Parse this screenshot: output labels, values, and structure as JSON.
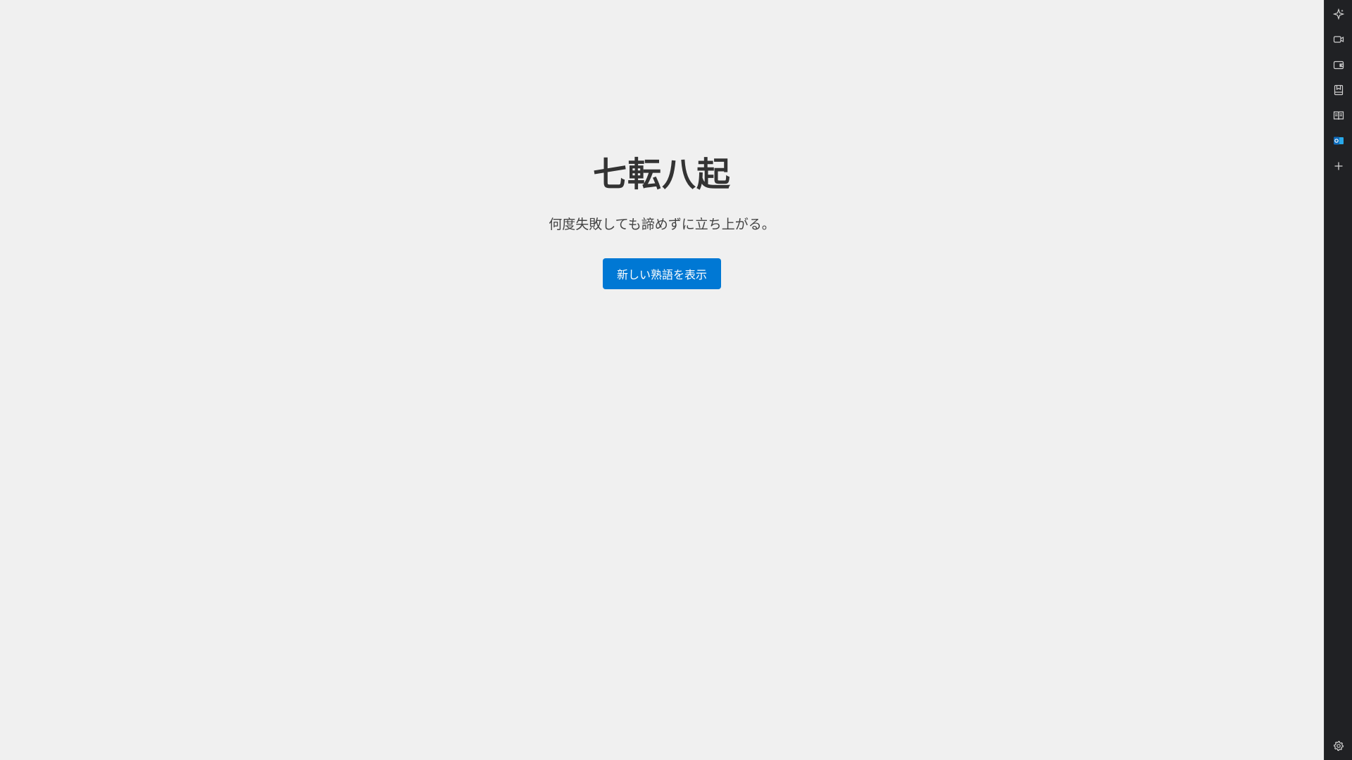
{
  "main": {
    "idiom": "七転八起",
    "meaning": "何度失敗しても諦めずに立ち上がる。",
    "button_label": "新しい熟語を表示",
    "button_color": "#0078d4"
  },
  "sidebar": {
    "background": "#202124",
    "items": [
      {
        "icon": "sparkle-icon"
      },
      {
        "icon": "video-icon"
      },
      {
        "icon": "wallet-icon"
      },
      {
        "icon": "bookmark-icon"
      },
      {
        "icon": "reading-view-icon"
      },
      {
        "icon": "outlook-icon"
      },
      {
        "icon": "add-icon"
      }
    ],
    "bottom_items": [
      {
        "icon": "settings-icon"
      }
    ]
  }
}
